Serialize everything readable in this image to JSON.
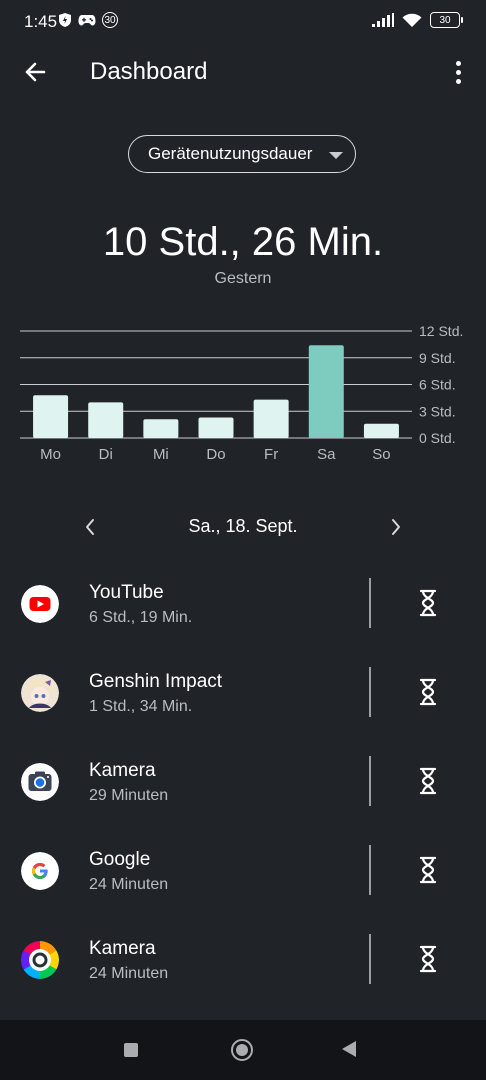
{
  "status_bar": {
    "time": "1:45",
    "badge": "30",
    "battery": "30",
    "icons": [
      "shield-icon",
      "game-controller-icon",
      "signal-icon",
      "wifi-icon",
      "battery-icon"
    ]
  },
  "header": {
    "title": "Dashboard",
    "icons": [
      "back-arrow-icon",
      "more-vert-icon"
    ]
  },
  "selector": {
    "value": "Gerätenutzungsdauer",
    "icon": "dropdown-arrow-icon"
  },
  "summary": {
    "total": "10 Std., 26 Min.",
    "day": "Gestern"
  },
  "colors": {
    "background": "#202429",
    "bar_default": "#dff3f0",
    "bar_selected": "#7ecbc0",
    "gridline": "#c9cdd1",
    "text_secondary": "#b8bdc2"
  },
  "chart_data": {
    "type": "bar",
    "categories": [
      "Mo",
      "Di",
      "Mi",
      "Do",
      "Fr",
      "Sa",
      "So"
    ],
    "values": [
      4.8,
      4.0,
      2.1,
      2.3,
      4.3,
      10.4,
      1.6
    ],
    "unit": "Std.",
    "y_ticks": [
      "12 Std.",
      "9 Std.",
      "6 Std.",
      "3 Std.",
      "0 Std."
    ],
    "y_tick_values": [
      12,
      9,
      6,
      3,
      0
    ],
    "ylim": [
      0,
      12
    ],
    "selected_category": "Sa",
    "grid": true
  },
  "date_nav": {
    "label": "Sa., 18. Sept.",
    "icons": [
      "chevron-left-icon",
      "chevron-right-icon"
    ]
  },
  "apps": [
    {
      "name": "YouTube",
      "time": "6 Std., 19 Min.",
      "icon": "youtube-icon"
    },
    {
      "name": "Genshin Impact",
      "time": "1 Std., 34 Min.",
      "icon": "genshin-impact-icon"
    },
    {
      "name": "Kamera",
      "time": "29 Minuten",
      "icon": "camera-icon"
    },
    {
      "name": "Google",
      "time": "24 Minuten",
      "icon": "google-icon"
    },
    {
      "name": "Kamera",
      "time": "24 Minuten",
      "icon": "camera-color-icon"
    }
  ],
  "nav_bar": {
    "icons": [
      "recents-icon",
      "home-icon",
      "back-icon"
    ]
  }
}
